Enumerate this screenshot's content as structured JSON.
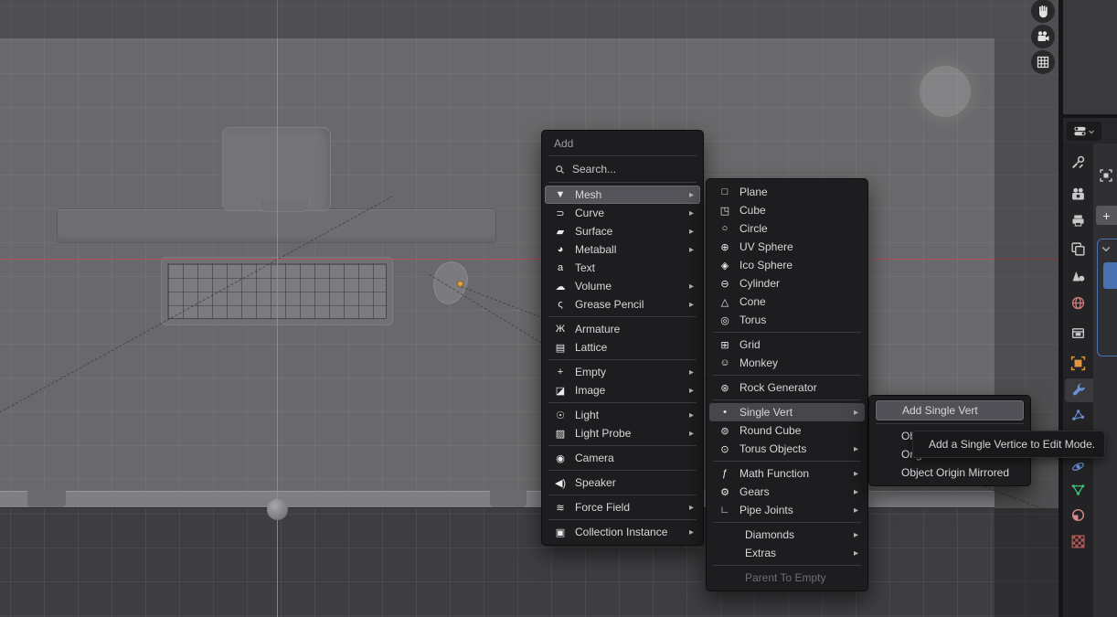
{
  "viewport": {
    "gizmo_icons": [
      "pan-hand-icon",
      "camera-view-icon",
      "grid-ortho-icon"
    ],
    "colors": {
      "background": "#69696b",
      "passepartout": "#4b4b4d",
      "floor": "#3e3e41",
      "axis_x": "#bc4e54",
      "axis_y": "#84aa42",
      "origin_dot": "#eba13f"
    }
  },
  "glyphs": {
    "submenu_arrow": "▸"
  },
  "add_menu": {
    "title": "Add",
    "search_label": "Search...",
    "items": [
      {
        "label": "Mesh",
        "icon": "▼",
        "submenu": true,
        "highlighted": true
      },
      {
        "label": "Curve",
        "icon": "⊃",
        "submenu": true
      },
      {
        "label": "Surface",
        "icon": "▰",
        "submenu": true
      },
      {
        "label": "Metaball",
        "icon": "◕",
        "submenu": true
      },
      {
        "label": "Text",
        "icon": "a",
        "submenu": false
      },
      {
        "label": "Volume",
        "icon": "☁",
        "submenu": true
      },
      {
        "label": "Grease Pencil",
        "icon": "ς",
        "submenu": true
      },
      {
        "label": "Armature",
        "icon": "Ж",
        "submenu": false
      },
      {
        "label": "Lattice",
        "icon": "▤",
        "submenu": false
      },
      {
        "label": "Empty",
        "icon": "+",
        "submenu": true
      },
      {
        "label": "Image",
        "icon": "◪",
        "submenu": true
      },
      {
        "label": "Light",
        "icon": "☉",
        "submenu": true
      },
      {
        "label": "Light Probe",
        "icon": "▨",
        "submenu": true
      },
      {
        "label": "Camera",
        "icon": "◉",
        "submenu": false
      },
      {
        "label": "Speaker",
        "icon": "◀)",
        "submenu": false
      },
      {
        "label": "Force Field",
        "icon": "≋",
        "submenu": true
      },
      {
        "label": "Collection Instance",
        "icon": "▣",
        "submenu": true
      }
    ]
  },
  "mesh_menu": {
    "items": [
      {
        "label": "Plane",
        "icon": "□"
      },
      {
        "label": "Cube",
        "icon": "◳"
      },
      {
        "label": "Circle",
        "icon": "○"
      },
      {
        "label": "UV Sphere",
        "icon": "⊕"
      },
      {
        "label": "Ico Sphere",
        "icon": "◈"
      },
      {
        "label": "Cylinder",
        "icon": "⊖"
      },
      {
        "label": "Cone",
        "icon": "△"
      },
      {
        "label": "Torus",
        "icon": "◎"
      },
      {
        "label": "Grid",
        "icon": "⊞"
      },
      {
        "label": "Monkey",
        "icon": "☺"
      },
      {
        "label": "Rock Generator",
        "icon": "⊛"
      },
      {
        "label": "Single Vert",
        "icon": "•",
        "submenu": true,
        "highlighted": true
      },
      {
        "label": "Round Cube",
        "icon": "⊜"
      },
      {
        "label": "Torus Objects",
        "icon": "⊙",
        "submenu": true
      },
      {
        "label": "Math Function",
        "icon": "ƒ",
        "submenu": true
      },
      {
        "label": "Gears",
        "icon": "⚙",
        "submenu": true
      },
      {
        "label": "Pipe Joints",
        "icon": "∟",
        "submenu": true
      },
      {
        "label": "Diamonds",
        "icon": "",
        "submenu": true
      },
      {
        "label": "Extras",
        "icon": "",
        "submenu": true
      },
      {
        "label": "Parent To Empty",
        "icon": "",
        "disabled": true
      }
    ]
  },
  "single_vert_menu": {
    "items": [
      {
        "label": "Add Single Vert",
        "highlighted": true
      },
      {
        "label": "Obj"
      },
      {
        "label": "Orig"
      },
      {
        "label": "Object Origin Mirrored"
      }
    ]
  },
  "tooltip": {
    "text": "Add a Single Vertice to Edit Mode."
  },
  "properties": {
    "plus_label": "+",
    "editor_selector_icon": "properties-editor-icon",
    "tabs": [
      {
        "icon": "tool-icon"
      },
      {
        "icon": "render-icon"
      },
      {
        "icon": "output-icon"
      },
      {
        "icon": "view-layer-icon"
      },
      {
        "icon": "scene-icon"
      },
      {
        "icon": "world-icon"
      },
      {
        "icon": "collection-icon"
      },
      {
        "icon": "object-icon"
      },
      {
        "icon": "modifiers-icon",
        "active": true
      },
      {
        "icon": "particles-icon"
      },
      {
        "icon": "physics-icon"
      },
      {
        "icon": "object-data-icon"
      },
      {
        "icon": "material-icon"
      },
      {
        "icon": "texture-icon"
      }
    ],
    "colors": {
      "accent_blue": "#4a72b4",
      "object_orange": "#e09445",
      "icon_blue": "#6b8fd8",
      "data_green": "#43c57a",
      "material_pink": "#d88a8a",
      "texture_red": "#b25555",
      "world_red": "#cf7676"
    }
  }
}
